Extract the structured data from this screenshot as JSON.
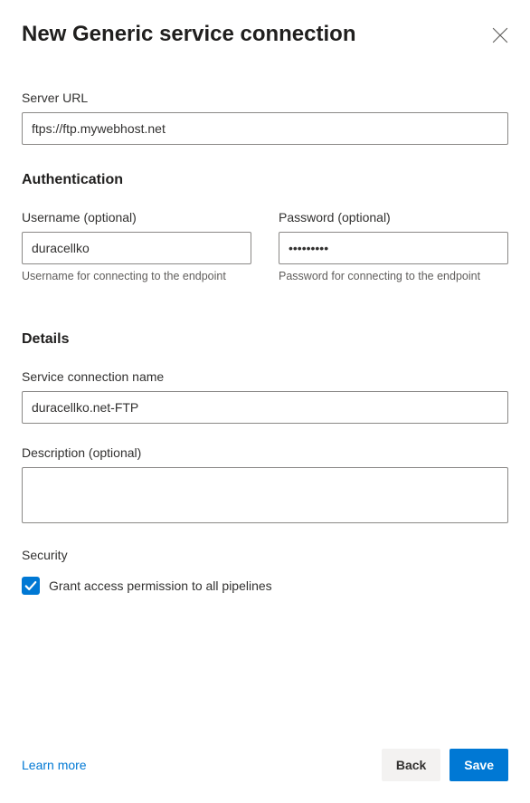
{
  "header": {
    "title": "New Generic service connection"
  },
  "fields": {
    "serverUrl": {
      "label": "Server URL",
      "value": "ftps://ftp.mywebhost.net"
    }
  },
  "auth": {
    "heading": "Authentication",
    "username": {
      "label": "Username (optional)",
      "value": "duracellko",
      "helper": "Username for connecting to the endpoint"
    },
    "password": {
      "label": "Password (optional)",
      "value": "•••••••••",
      "helper": "Password for connecting to the endpoint"
    }
  },
  "details": {
    "heading": "Details",
    "serviceName": {
      "label": "Service connection name",
      "value": "duracellko.net-FTP"
    },
    "description": {
      "label": "Description (optional)",
      "value": ""
    }
  },
  "security": {
    "label": "Security",
    "checkbox": {
      "checked": true,
      "label": "Grant access permission to all pipelines"
    }
  },
  "footer": {
    "learnMore": "Learn more",
    "back": "Back",
    "save": "Save"
  }
}
